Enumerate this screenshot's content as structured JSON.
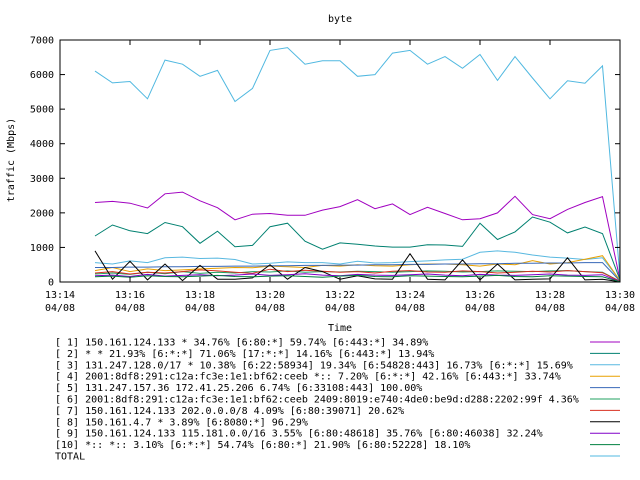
{
  "chart_data": {
    "type": "line",
    "title": "byte",
    "xlabel": "Time",
    "ylabel": "traffic (Mbps)",
    "ylim": [
      0,
      7000
    ],
    "yticks": [
      0,
      1000,
      2000,
      3000,
      4000,
      5000,
      6000,
      7000
    ],
    "grid": false,
    "legend_position": "bottom",
    "x_range": [
      "13:14",
      "13:30"
    ],
    "xticks": [
      {
        "t": "13:14",
        "date": "04/08"
      },
      {
        "t": "13:16",
        "date": "04/08"
      },
      {
        "t": "13:18",
        "date": "04/08"
      },
      {
        "t": "13:20",
        "date": "04/08"
      },
      {
        "t": "13:22",
        "date": "04/08"
      },
      {
        "t": "13:24",
        "date": "04/08"
      },
      {
        "t": "13:26",
        "date": "04/08"
      },
      {
        "t": "13:28",
        "date": "04/08"
      },
      {
        "t": "13:30",
        "date": "04/08"
      }
    ],
    "x_minutes": [
      15.0,
      15.5,
      16.0,
      16.5,
      17.0,
      17.5,
      18.0,
      18.5,
      19.0,
      19.5,
      20.0,
      20.5,
      21.0,
      21.5,
      22.0,
      22.5,
      23.0,
      23.5,
      24.0,
      24.5,
      25.0,
      25.5,
      26.0,
      26.5,
      27.0,
      27.5,
      28.0,
      28.5,
      29.0,
      29.5,
      30.0
    ],
    "series": [
      {
        "name": "[ 1] 150.161.124.133 * 34.76%  [6:80:*] 59.74% [6:443:*] 34.89%",
        "color": "#a000c0",
        "values": [
          2300,
          2330,
          2280,
          2140,
          2550,
          2600,
          2350,
          2150,
          1800,
          1960,
          1980,
          1930,
          1930,
          2080,
          2180,
          2380,
          2120,
          2260,
          1950,
          2160,
          1980,
          1800,
          1830,
          2000,
          2480,
          1950,
          1830,
          2100,
          2300,
          2470,
          60
        ]
      },
      {
        "name": "[ 2] * * 21.93%  [6:*:*] 71.06% [17:*:*] 14.16% [6:443:*] 13.94%",
        "color": "#008070",
        "values": [
          1330,
          1650,
          1480,
          1400,
          1720,
          1600,
          1120,
          1470,
          1020,
          1060,
          1600,
          1700,
          1180,
          950,
          1130,
          1090,
          1040,
          1010,
          1010,
          1080,
          1070,
          1030,
          1700,
          1230,
          1450,
          1880,
          1730,
          1420,
          1590,
          1400,
          60
        ]
      },
      {
        "name": "[ 3] 131.247.128.0/17 * 10.38%  [6:22:58934] 19.34% [6:54828:443] 16.73% [6:*:*] 15.69%",
        "color": "#58b8e0",
        "values": [
          560,
          520,
          610,
          560,
          700,
          720,
          680,
          690,
          650,
          520,
          540,
          580,
          560,
          560,
          520,
          600,
          550,
          560,
          590,
          610,
          640,
          660,
          860,
          900,
          860,
          780,
          720,
          690,
          650,
          700,
          40
        ]
      },
      {
        "name": "[ 4] 2001:8df8:291:c12a:fc3e:1e1:bf62:ceeb *:: 7.20%  [6:*:*] 42.16% [6:443:*] 33.74%",
        "color": "#e8a000",
        "values": [
          330,
          420,
          300,
          380,
          330,
          350,
          380,
          400,
          420,
          410,
          460,
          440,
          420,
          480,
          460,
          500,
          470,
          460,
          500,
          520,
          520,
          500,
          460,
          520,
          500,
          620,
          520,
          560,
          660,
          760,
          40
        ]
      },
      {
        "name": "[ 5] 131.247.157.36 172.41.25.206 6.74%  [6:33108:443] 100.00%",
        "color": "#3868b8",
        "values": [
          420,
          420,
          430,
          430,
          440,
          440,
          450,
          450,
          460,
          460,
          470,
          470,
          480,
          480,
          490,
          490,
          500,
          500,
          510,
          510,
          520,
          520,
          530,
          530,
          540,
          540,
          550,
          550,
          560,
          560,
          30
        ]
      },
      {
        "name": "[ 6] 2001:8df8:291:c12a:fc3e:1e1:bf62:ceeb 2409:8019:e740:4de0:be9d:d288:2202:99f 4.36%",
        "color": "#20a060",
        "values": [
          230,
          260,
          220,
          280,
          240,
          300,
          250,
          280,
          260,
          300,
          290,
          320,
          280,
          300,
          290,
          310,
          300,
          280,
          300,
          320,
          310,
          290,
          300,
          320,
          310,
          300,
          320,
          330,
          300,
          280,
          20
        ]
      },
      {
        "name": "[ 7] 150.161.124.133 202.0.0.0/8 4.09%  [6:80:39071] 20.62%",
        "color": "#d83020",
        "values": [
          260,
          300,
          230,
          280,
          260,
          300,
          350,
          320,
          280,
          250,
          370,
          300,
          340,
          310,
          280,
          300,
          260,
          310,
          330,
          290,
          280,
          320,
          300,
          260,
          280,
          310,
          290,
          330,
          300,
          270,
          20
        ]
      },
      {
        "name": "[ 8] 150.161.4.7 * 3.89%  [6:8080:*] 96.29%",
        "color": "#000000",
        "values": [
          900,
          80,
          600,
          60,
          520,
          40,
          480,
          80,
          80,
          120,
          500,
          80,
          420,
          300,
          80,
          180,
          90,
          80,
          820,
          80,
          60,
          640,
          60,
          520,
          60,
          80,
          90,
          700,
          60,
          80,
          10
        ]
      },
      {
        "name": "[ 9] 150.161.124.133 115.181.0.0/16 3.55%  [6:80:48618] 35.76% [6:80:46038] 32.24%",
        "color": "#8000c8",
        "values": [
          180,
          200,
          160,
          220,
          170,
          190,
          210,
          180,
          200,
          230,
          190,
          210,
          240,
          200,
          180,
          220,
          200,
          190,
          210,
          230,
          200,
          180,
          220,
          200,
          190,
          210,
          230,
          200,
          190,
          210,
          10
        ]
      },
      {
        "name": "[10] *:: *:: 3.10%  [6:*:*] 54.74% [6:80:*] 21.90% [6:80:52228] 18.10%",
        "color": "#008040",
        "values": [
          150,
          170,
          140,
          180,
          160,
          150,
          170,
          190,
          160,
          150,
          170,
          180,
          160,
          140,
          170,
          190,
          160,
          150,
          180,
          170,
          160,
          150,
          170,
          190,
          160,
          150,
          180,
          170,
          160,
          150,
          10
        ]
      },
      {
        "name": "TOTAL",
        "color": "#50b8e0",
        "values": [
          6100,
          5760,
          5800,
          5300,
          6420,
          6300,
          5950,
          6120,
          5220,
          5600,
          6700,
          6780,
          6300,
          6400,
          6400,
          5950,
          6000,
          6620,
          6700,
          6300,
          6520,
          6180,
          6580,
          5830,
          6520,
          5900,
          5300,
          5820,
          5750,
          6250,
          120
        ]
      }
    ]
  }
}
